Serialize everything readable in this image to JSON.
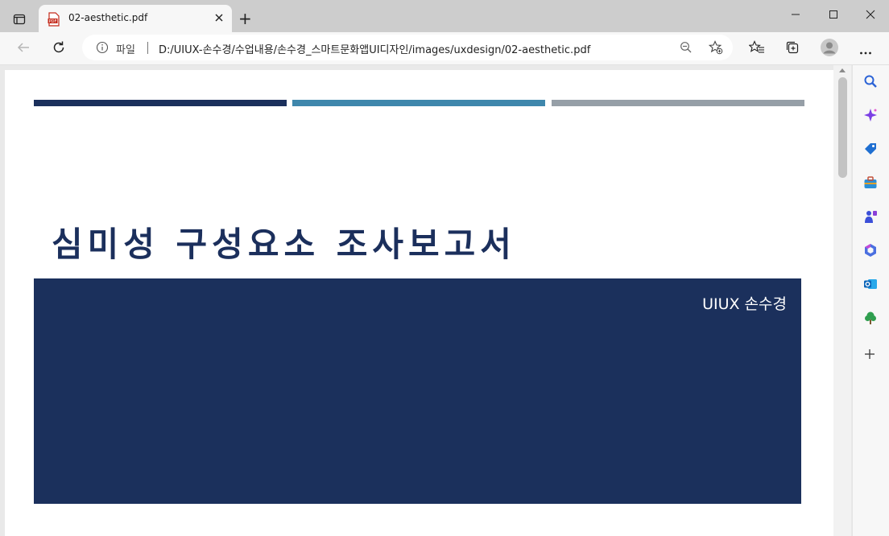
{
  "browser": {
    "tab": {
      "title": "02-aesthetic.pdf",
      "favicon_label": "PDF"
    },
    "new_tab_label": "+",
    "window_controls": [
      "minimize",
      "maximize",
      "close"
    ],
    "address_bar": {
      "security_label": "파일",
      "url": "D:/UIUX-손수경/수업내용/손수경_스마트문화앱UI디자인/images/uxdesign/02-aesthetic.pdf"
    },
    "toolbar_icons": [
      "back-icon",
      "refresh-icon",
      "info-icon",
      "zoom-out-icon",
      "add-favorite-icon",
      "favorites-icon",
      "collections-icon",
      "profile-icon",
      "more-icon"
    ],
    "sidebar_icons": [
      "search-icon",
      "copilot-icon",
      "shopping-icon",
      "tools-icon",
      "games-icon",
      "office-icon",
      "outlook-icon",
      "tree-icon",
      "add-icon"
    ]
  },
  "document": {
    "title": "심미성 구성요소 조사보고서",
    "author": "UIUX 손수경",
    "colors": {
      "navy": "#1b305c",
      "teal": "#3f87ac",
      "gray": "#969fa7"
    }
  }
}
